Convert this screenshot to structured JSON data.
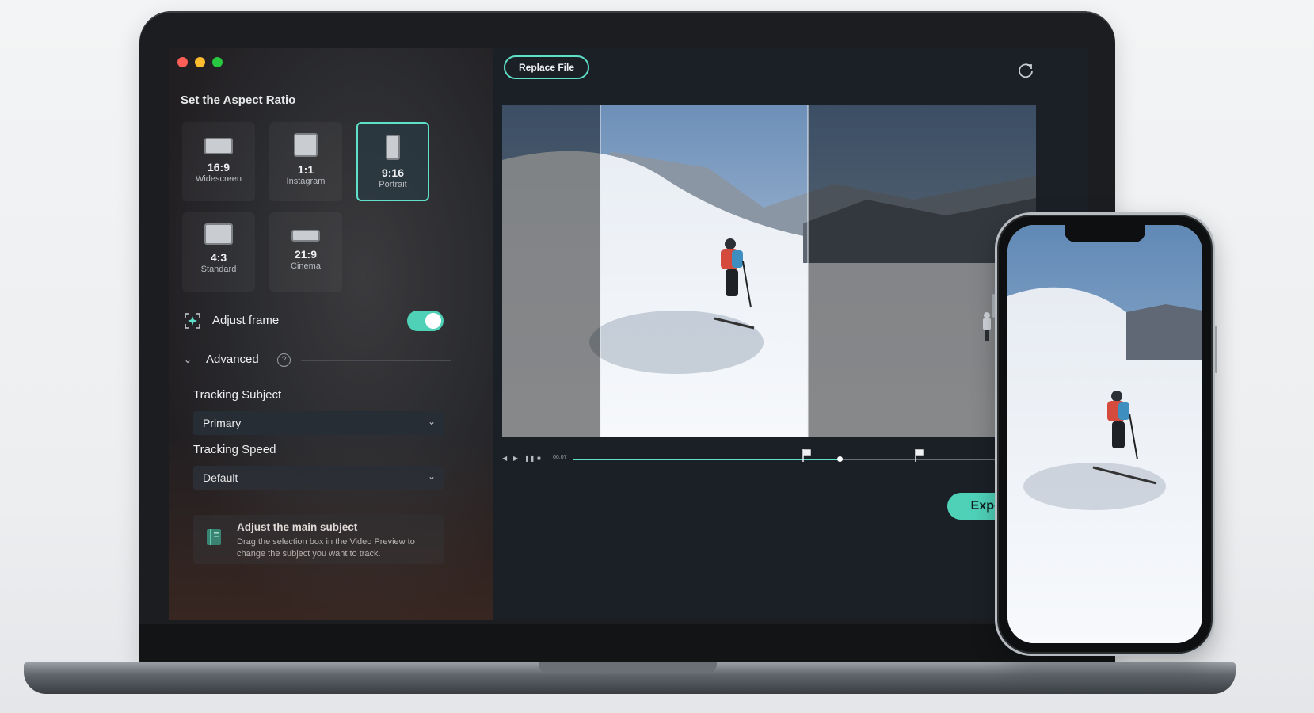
{
  "left_panel": {
    "section_title": "Set the Aspect Ratio",
    "ratios": [
      {
        "value": "16:9",
        "name": "Widescreen",
        "selected": false
      },
      {
        "value": "1:1",
        "name": "Instagram",
        "selected": false
      },
      {
        "value": "9:16",
        "name": "Portrait",
        "selected": true
      },
      {
        "value": "4:3",
        "name": "Standard",
        "selected": false
      },
      {
        "value": "21:9",
        "name": "Cinema",
        "selected": false
      }
    ],
    "adjust_frame": {
      "label": "Adjust frame",
      "enabled": true
    },
    "advanced": {
      "label": "Advanced",
      "help": "?"
    },
    "tracking_subject": {
      "label": "Tracking Subject",
      "value": "Primary"
    },
    "tracking_speed": {
      "label": "Tracking Speed",
      "value": "Default"
    },
    "hint": {
      "title": "Adjust the main subject",
      "text": "Drag the selection box in the Video Preview to change the subject you want to track."
    }
  },
  "right_panel": {
    "replace_label": "Replace File",
    "timecode": "00:07",
    "progress": 0.6,
    "export_label": "Export"
  },
  "icons": {
    "refresh": "refresh-icon",
    "adjust": "adjust-frame-icon",
    "hint": "book-icon"
  },
  "colors": {
    "accent": "#5fe0c8",
    "panel_bg": "#1b2027"
  }
}
